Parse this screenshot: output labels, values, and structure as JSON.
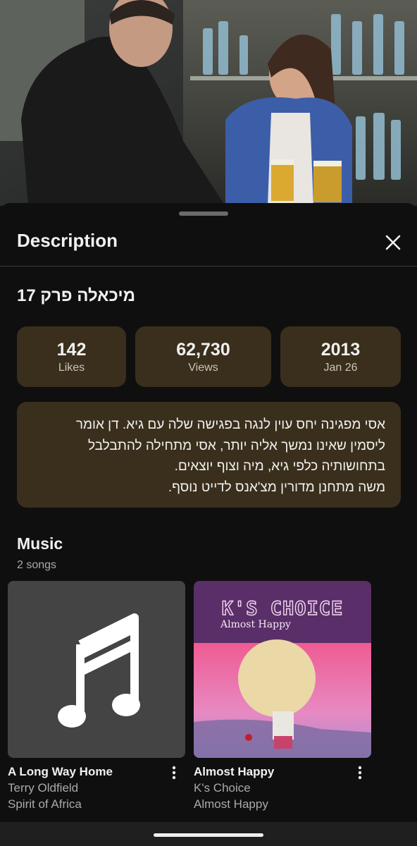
{
  "sheet": {
    "title": "Description",
    "close_icon": "close-icon"
  },
  "video": {
    "title": "מיכאלה פרק 17",
    "stats": [
      {
        "value": "142",
        "label": "Likes"
      },
      {
        "value": "62,730",
        "label": "Views"
      },
      {
        "value": "2013",
        "label": "Jan 26"
      }
    ],
    "description_lines": [
      "אסי מפגינה יחס עוין לנגה בפגישה שלה עם גיא. דן אומר",
      "ליסמין שאינו נמשך אליה יותר, אסי מתחילה להתבלבל",
      "בתחושותיה כלפי גיא, מיה וצוף יוצאים.",
      "משה מתחנן מדורין מצ'אנס לדייט נוסף."
    ]
  },
  "music": {
    "heading": "Music",
    "count": "2 songs",
    "songs": [
      {
        "title": "A Long Way Home",
        "artist": "Terry Oldfield",
        "album": "Spirit of Africa",
        "art_icon": "music-note-icon"
      },
      {
        "title": "Almost Happy",
        "artist": "K's Choice",
        "album": "Almost Happy",
        "art_band": "K'S CHOICE",
        "art_album": "Almost Happy"
      }
    ]
  },
  "colors": {
    "background": "#0f0f0f",
    "card": "#3a2f1c",
    "text_primary": "#f1f1f1",
    "text_secondary": "#aaaaaa"
  }
}
